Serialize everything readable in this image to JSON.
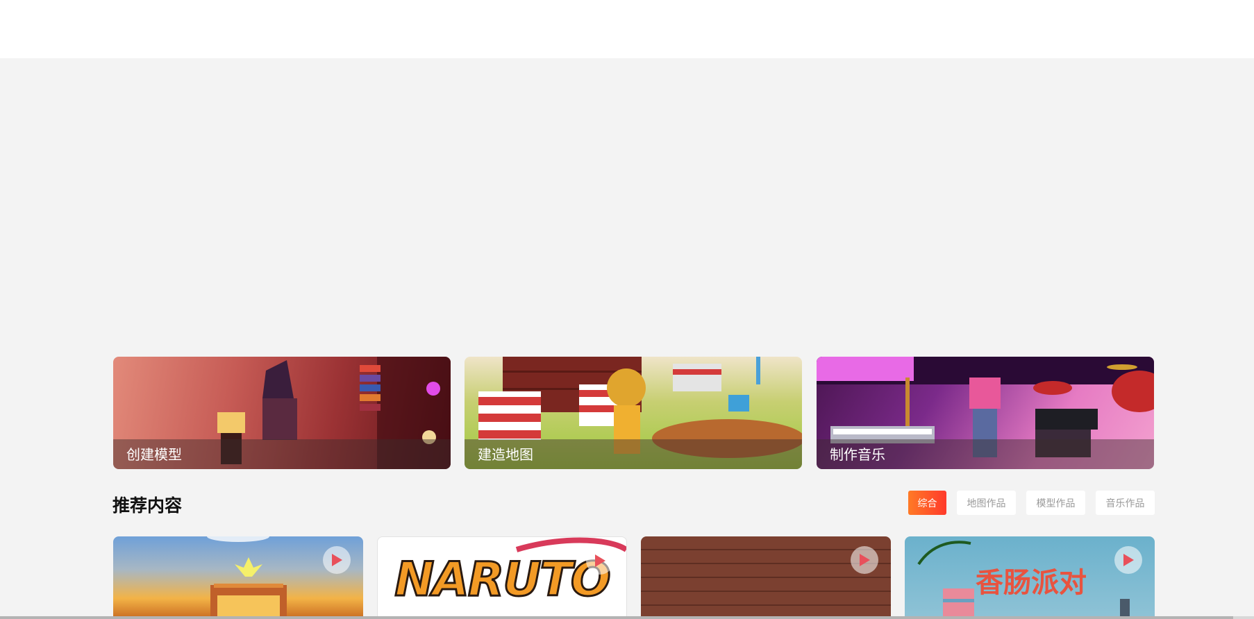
{
  "feature_cards": [
    {
      "label": "创建模型"
    },
    {
      "label": "建造地图"
    },
    {
      "label": "制作音乐"
    }
  ],
  "section": {
    "title": "推荐内容"
  },
  "filters": {
    "tabs": [
      {
        "label": "综合",
        "active": true
      },
      {
        "label": "地图作品",
        "active": false
      },
      {
        "label": "模型作品",
        "active": false
      },
      {
        "label": "音乐作品",
        "active": false
      }
    ]
  },
  "content_cards": [
    {
      "thumb_text": ""
    },
    {
      "thumb_text": "NARUTO"
    },
    {
      "thumb_text": ""
    },
    {
      "thumb_text": "香肠派对"
    }
  ],
  "colors": {
    "accent_start": "#ff7a26",
    "accent_end": "#ff3a2b",
    "page_background": "#f3f3f3",
    "play_icon": "#e8505b"
  },
  "icons": {
    "play": "play-icon"
  }
}
